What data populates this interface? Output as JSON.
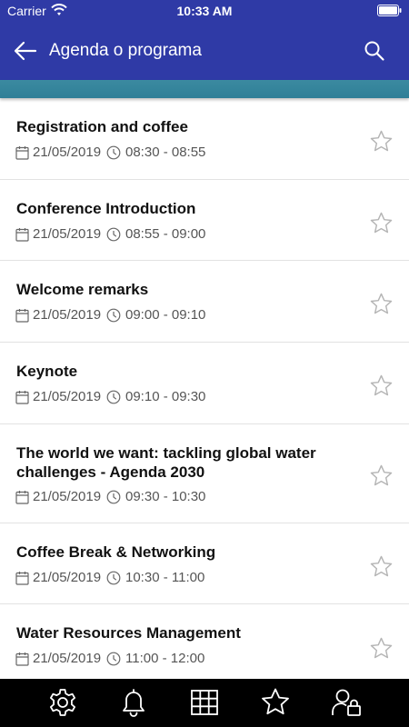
{
  "status_bar": {
    "carrier": "Carrier",
    "time": "10:33 AM"
  },
  "app_bar": {
    "title": "Agenda o programa",
    "back_icon": "back-arrow-icon",
    "search_icon": "search-icon"
  },
  "agenda": [
    {
      "title": "Registration and coffee",
      "date": "21/05/2019",
      "time": "08:30 - 08:55"
    },
    {
      "title": "Conference Introduction",
      "date": "21/05/2019",
      "time": "08:55 - 09:00"
    },
    {
      "title": "Welcome remarks",
      "date": "21/05/2019",
      "time": "09:00 - 09:10"
    },
    {
      "title": "Keynote",
      "date": "21/05/2019",
      "time": "09:10 - 09:30"
    },
    {
      "title": "The world we want: tackling global water challenges - Agenda 2030",
      "date": "21/05/2019",
      "time": "09:30 - 10:30"
    },
    {
      "title": "Coffee Break & Networking",
      "date": "21/05/2019",
      "time": "10:30 - 11:00"
    },
    {
      "title": "Water Resources Management",
      "date": "21/05/2019",
      "time": "11:00 - 12:00"
    }
  ],
  "tab_bar": [
    "settings-gear-icon",
    "notifications-bell-icon",
    "grid-icon",
    "favorites-star-icon",
    "profile-lock-icon"
  ],
  "colors": {
    "header": "#2f3aa6",
    "strip": "#2f7f97",
    "tab_bar": "#000000",
    "star": "#b5b5b5"
  }
}
